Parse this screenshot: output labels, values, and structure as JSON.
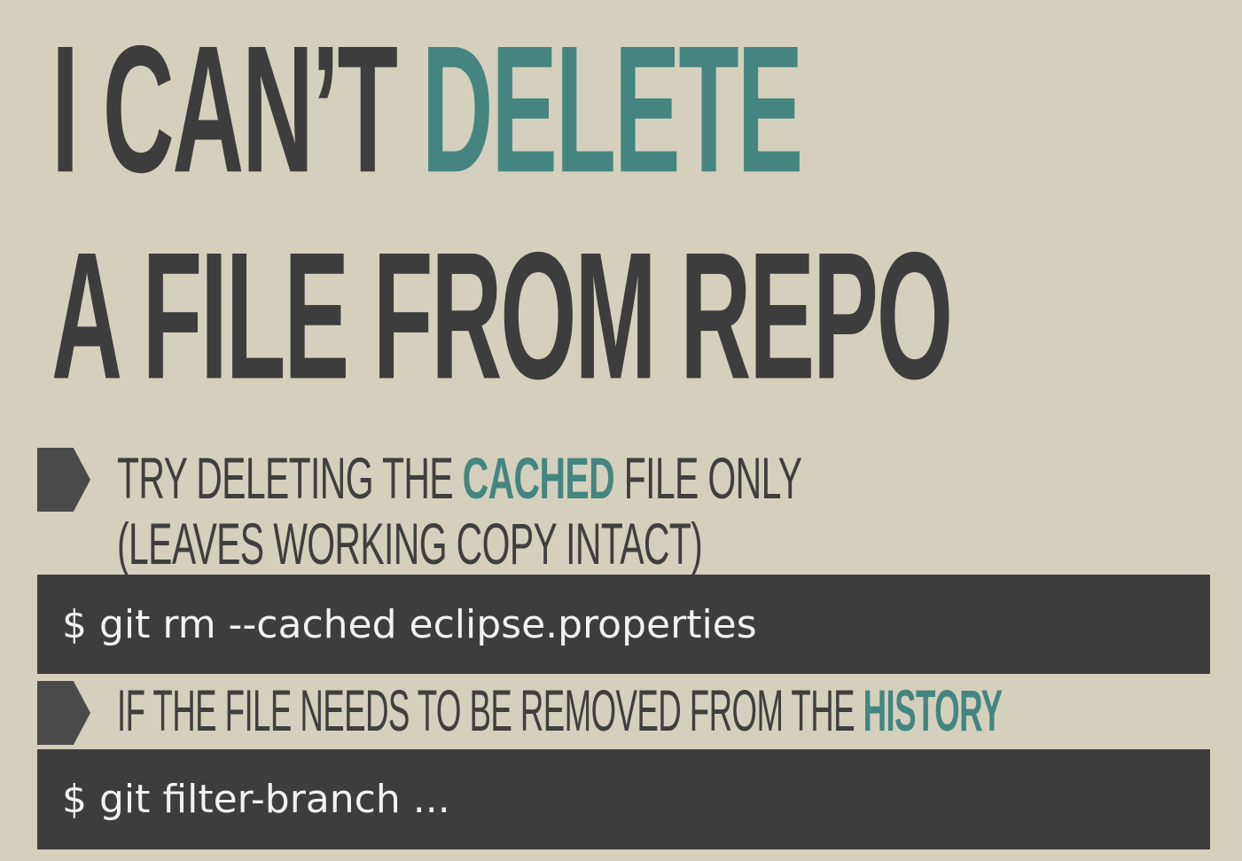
{
  "title": {
    "line1_part1": "I CAN’T ",
    "line1_accent": "DELETE",
    "line2": "A FILE FROM REPO"
  },
  "bullets": [
    {
      "text_before": "TRY DELETING THE ",
      "accent": "CACHED",
      "text_after": " FILE ONLY",
      "line2": "(LEAVES WORKING COPY INTACT)"
    },
    {
      "text_before": "IF THE FILE NEEDS TO BE REMOVED FROM THE ",
      "accent": "HISTORY"
    }
  ],
  "code": [
    "$ git rm --cached eclipse.properties",
    "$ git filter-branch ..."
  ],
  "colors": {
    "background": "#d4d0bd",
    "text_dark": "#3d3d3d",
    "accent": "#448580",
    "code_background": "#3d3d3d",
    "code_text": "#f2f2f2"
  },
  "icons": [
    "bullet-arrow-icon"
  ]
}
